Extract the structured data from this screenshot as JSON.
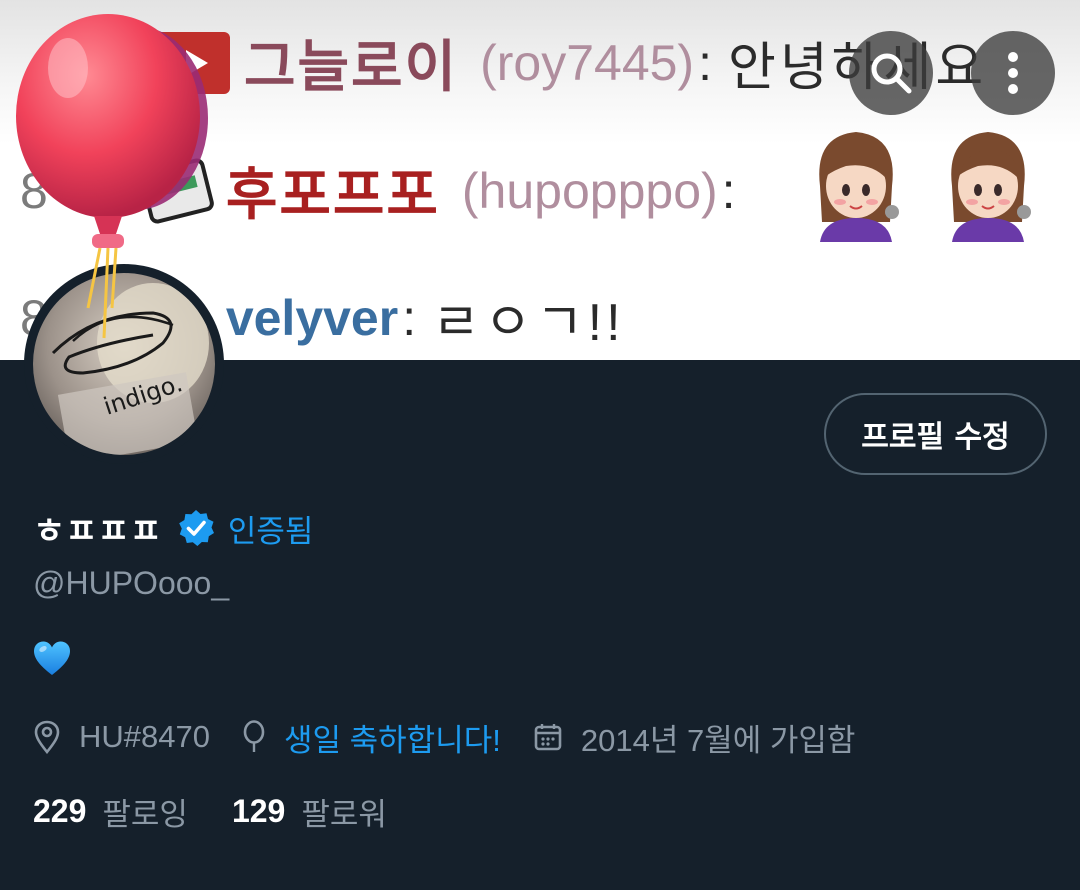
{
  "banner": {
    "lines": [
      {
        "prefix": "",
        "nickname": "그늘로이",
        "handle": "(roy7445)",
        "colon": ":",
        "message": "안녕하세요"
      },
      {
        "prefix": "8",
        "nickname": "후포프포",
        "handle": "(hupopppo)",
        "colon": ":",
        "message": ""
      },
      {
        "prefix": "8",
        "nickname": "velyver",
        "handle": "",
        "colon": ":",
        "message": "ㄹㅇㄱ!!"
      }
    ]
  },
  "toolbar": {
    "search_icon": "search-icon",
    "more_icon": "more-vertical-icon"
  },
  "avatar": {
    "caption": "indigo."
  },
  "edit_button": {
    "label": "프로필 수정"
  },
  "profile": {
    "display_name": "ㅎㅍㅍㅍ",
    "verified_label": "인증됨",
    "handle": "@HUPOooo_",
    "bio_icon": "blue-heart-emoji"
  },
  "meta": {
    "location": "HU#8470",
    "birthday": "생일 축하합니다!",
    "joined": "2014년 7월에 가입함"
  },
  "follow": {
    "following_count": "229",
    "following_label": "팔로잉",
    "followers_count": "129",
    "followers_label": "팔로워"
  },
  "colors": {
    "background": "#15202b",
    "accent": "#1d9bf0",
    "muted": "#8b98a5",
    "border": "#536471"
  }
}
